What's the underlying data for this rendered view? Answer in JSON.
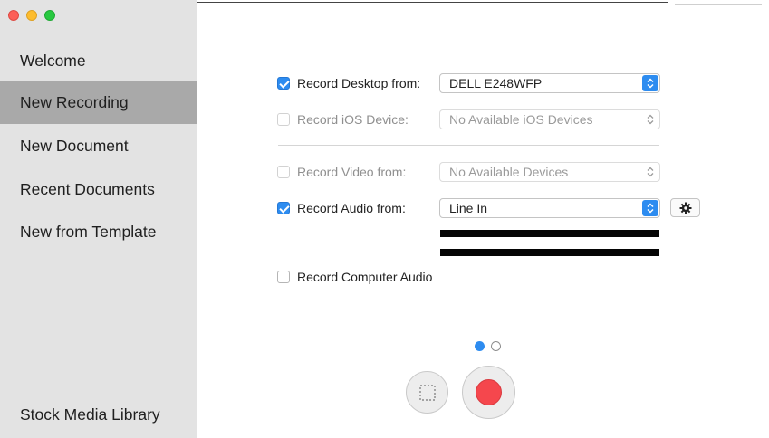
{
  "sidebar": {
    "items": [
      {
        "label": "Welcome"
      },
      {
        "label": "New Recording"
      },
      {
        "label": "New Document"
      },
      {
        "label": "Recent Documents"
      },
      {
        "label": "New from Template"
      }
    ],
    "footer_item": {
      "label": "Stock Media Library"
    },
    "selected": "New Recording"
  },
  "recording": {
    "desktop": {
      "label": "Record Desktop from:",
      "checked": true,
      "value": "DELL E248WFP"
    },
    "ios": {
      "label": "Record iOS Device:",
      "checked": false,
      "value": "No Available iOS Devices"
    },
    "video": {
      "label": "Record Video from:",
      "checked": false,
      "value": "No Available Devices"
    },
    "audio": {
      "label": "Record Audio from:",
      "checked": true,
      "value": "Line In"
    },
    "computer_audio": {
      "label": "Record Computer Audio",
      "checked": false
    }
  },
  "pager": {
    "current": 1,
    "total": 2
  },
  "colors": {
    "accent": "#2d8cf0",
    "record": "#f5474d",
    "sidebar_bg": "#e3e3e3",
    "selected_bg": "#a9a9a9"
  },
  "icons": [
    "close-window-icon",
    "minimize-window-icon",
    "zoom-window-icon",
    "select-arrows-icon",
    "gear-icon",
    "selection-area-icon",
    "record-icon"
  ]
}
